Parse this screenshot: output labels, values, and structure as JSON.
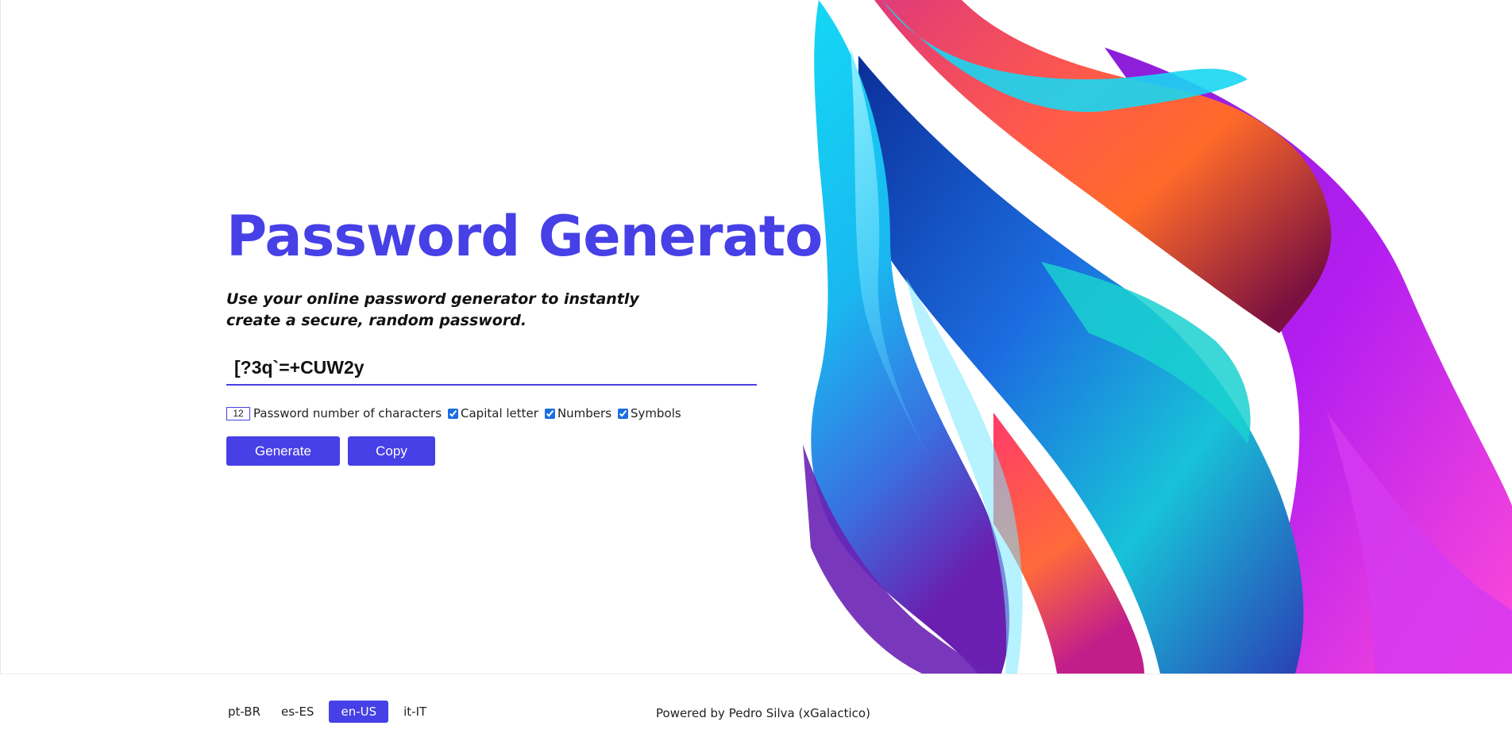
{
  "header": {
    "title": "Password Generator",
    "subtitle": "Use your online password generator to instantly create a secure, random password."
  },
  "generator": {
    "password_value": "[?3q`=+CUW2y",
    "length_value": "12",
    "length_label": "Password number of characters",
    "options": [
      {
        "label": "Capital letter",
        "checked": true
      },
      {
        "label": "Numbers",
        "checked": true
      },
      {
        "label": "Symbols",
        "checked": true
      }
    ],
    "generate_label": "Generate",
    "copy_label": "Copy"
  },
  "footer": {
    "languages": [
      {
        "label": "pt-BR",
        "active": false
      },
      {
        "label": "es-ES",
        "active": false
      },
      {
        "label": "en-US",
        "active": true
      },
      {
        "label": "it-IT",
        "active": false
      }
    ],
    "credit": "Powered by Pedro Silva (xGalactico)"
  },
  "colors": {
    "accent": "#4640e6",
    "text": "#111111"
  },
  "art": {
    "icon": "abstract-fluid-ribbon-art"
  }
}
